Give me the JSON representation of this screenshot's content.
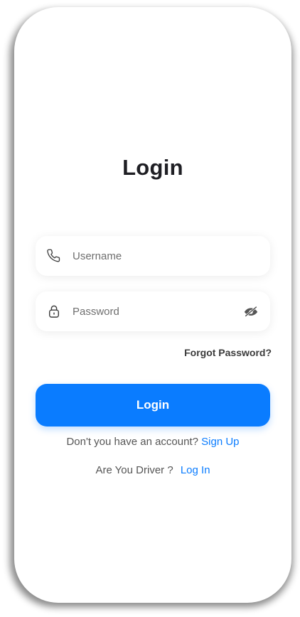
{
  "screen": {
    "title": "Login"
  },
  "username": {
    "placeholder": "Username",
    "value": "",
    "icon": "phone-icon"
  },
  "password": {
    "placeholder": "Password",
    "value": "",
    "icon": "lock-icon",
    "toggle_icon": "eye-off-icon"
  },
  "forgot_password": {
    "label": "Forgot Password?"
  },
  "login_button": {
    "label": "Login"
  },
  "signup_prompt": {
    "text": "Don't you have an account?",
    "link": "Sign Up"
  },
  "driver_prompt": {
    "text": "Are You Driver ?",
    "link": "Log In"
  },
  "colors": {
    "primary": "#0a7cff",
    "title": "#1f1f24",
    "muted_text": "#555555",
    "background": "#ffffff"
  }
}
